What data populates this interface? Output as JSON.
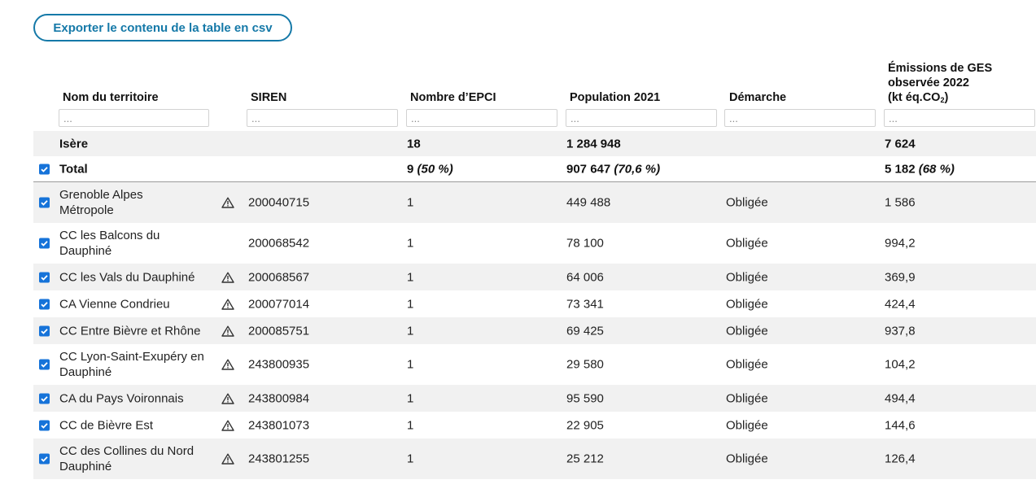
{
  "export_button": {
    "label": "Exporter le contenu de la table en csv"
  },
  "columns": {
    "nom": "Nom du territoire",
    "siren": "SIREN",
    "epci": "Nombre d’EPCI",
    "population": "Population 2021",
    "demarche": "Démarche",
    "ges_line1": "Émissions de GES",
    "ges_line2": "observée 2022",
    "ges_line3_pre": "(kt éq.CO",
    "ges_line3_sub": "2",
    "ges_line3_post": ")"
  },
  "filter_placeholder": "...",
  "summary": {
    "name": "Isère",
    "epci": "18",
    "population": "1 284 948",
    "ges": "7 624"
  },
  "total": {
    "name": "Total",
    "checked": true,
    "epci": "9",
    "epci_pct": "(50 %)",
    "population": "907 647",
    "population_pct": "(70,6 %)",
    "ges": "5 182",
    "ges_pct": "(68 %)"
  },
  "rows": [
    {
      "name_1": "Grenoble Alpes",
      "name_2": "Métropole",
      "warning": true,
      "siren": "200040715",
      "epci": "1",
      "population": "449 488",
      "demarche": "Obligée",
      "ges": "1 586",
      "checked": true
    },
    {
      "name_1": "CC les Balcons du",
      "name_2": "Dauphiné",
      "warning": false,
      "siren": "200068542",
      "epci": "1",
      "population": "78 100",
      "demarche": "Obligée",
      "ges": "994,2",
      "checked": true
    },
    {
      "name_1": "CC les Vals du Dauphiné",
      "name_2": "",
      "warning": true,
      "siren": "200068567",
      "epci": "1",
      "population": "64 006",
      "demarche": "Obligée",
      "ges": "369,9",
      "checked": true
    },
    {
      "name_1": "CA Vienne Condrieu",
      "name_2": "",
      "warning": true,
      "siren": "200077014",
      "epci": "1",
      "population": "73 341",
      "demarche": "Obligée",
      "ges": "424,4",
      "checked": true
    },
    {
      "name_1": "CC Entre Bièvre et Rhône",
      "name_2": "",
      "warning": true,
      "siren": "200085751",
      "epci": "1",
      "population": "69 425",
      "demarche": "Obligée",
      "ges": "937,8",
      "checked": true
    },
    {
      "name_1": "CC Lyon-Saint-Exupéry en",
      "name_2": "Dauphiné",
      "warning": true,
      "siren": "243800935",
      "epci": "1",
      "population": "29 580",
      "demarche": "Obligée",
      "ges": "104,2",
      "checked": true
    },
    {
      "name_1": "CA du Pays Voironnais",
      "name_2": "",
      "warning": true,
      "siren": "243800984",
      "epci": "1",
      "population": "95 590",
      "demarche": "Obligée",
      "ges": "494,4",
      "checked": true
    },
    {
      "name_1": "CC de Bièvre Est",
      "name_2": "",
      "warning": true,
      "siren": "243801073",
      "epci": "1",
      "population": "22 905",
      "demarche": "Obligée",
      "ges": "144,6",
      "checked": true
    },
    {
      "name_1": "CC des Collines du Nord",
      "name_2": "Dauphiné",
      "warning": true,
      "siren": "243801255",
      "epci": "1",
      "population": "25 212",
      "demarche": "Obligée",
      "ges": "126,4",
      "checked": true
    }
  ],
  "colors": {
    "accent": "#1579a8",
    "checkbox": "#1673d9",
    "row_shade": "#f1f1f1"
  }
}
